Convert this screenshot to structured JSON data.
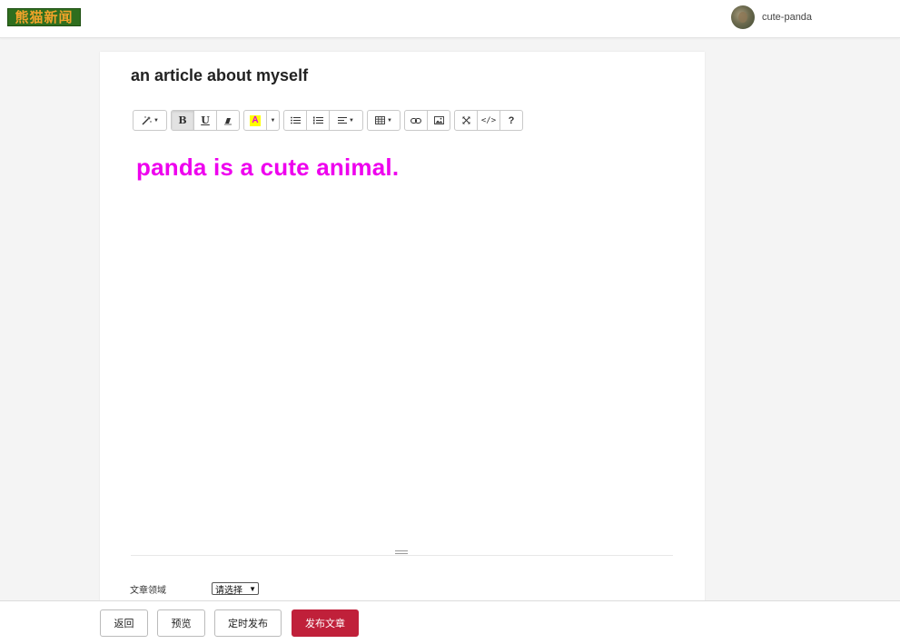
{
  "header": {
    "logo_text": "熊猫新闻",
    "username": "cute-panda"
  },
  "editor": {
    "title": "an article about myself",
    "content_text": "panda is a cute animal.",
    "content_color": "#ee00ee",
    "toolbar": {
      "groups": [
        [
          "magic-wand-icon-with-caret"
        ],
        [
          "bold-icon",
          "underline-icon",
          "eraser-icon"
        ],
        [
          "font-color-icon",
          "caret-icon"
        ],
        [
          "unordered-list-icon",
          "ordered-list-icon",
          "align-icon-with-caret"
        ],
        [
          "table-icon-with-caret"
        ],
        [
          "link-icon",
          "picture-icon"
        ],
        [
          "fullscreen-icon",
          "code-view-icon",
          "help-icon"
        ]
      ],
      "bold_glyph": "B",
      "underline_glyph": "U",
      "code_glyph": "</>",
      "help_glyph": "?",
      "font_color_glyph": "A"
    },
    "field_label": "文章领域",
    "field_select_value": "请选择"
  },
  "footer": {
    "back_label": "返回",
    "preview_label": "预览",
    "schedule_label": "定时发布",
    "publish_label": "发布文章",
    "primary_color": "#c0203a"
  }
}
